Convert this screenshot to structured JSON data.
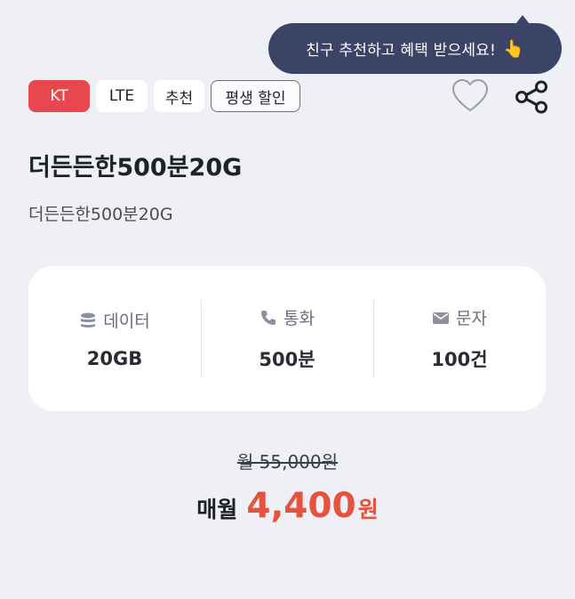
{
  "tooltip": {
    "text": "친구 추천하고 혜택 받으세요!",
    "icon": "pointing-hand-icon"
  },
  "badges": {
    "carrier": "KT",
    "network": "LTE",
    "recommend": "추천",
    "discount": "평생 할인"
  },
  "colors": {
    "carrier_badge": "#e8474f",
    "price_accent": "#e5533e",
    "tooltip_bg": "#3b4466",
    "page_bg": "#eef0f6"
  },
  "plan": {
    "title": "더든든한500분20G",
    "subtitle": "더든든한500분20G"
  },
  "specs": {
    "data": {
      "label": "데이터",
      "value": "20GB",
      "icon": "database-icon"
    },
    "call": {
      "label": "통화",
      "value": "500분",
      "icon": "phone-icon"
    },
    "sms": {
      "label": "문자",
      "value": "100건",
      "icon": "envelope-icon"
    }
  },
  "price": {
    "original": "월 55,000원",
    "prefix": "매월",
    "amount": "4,400",
    "unit": "원"
  }
}
